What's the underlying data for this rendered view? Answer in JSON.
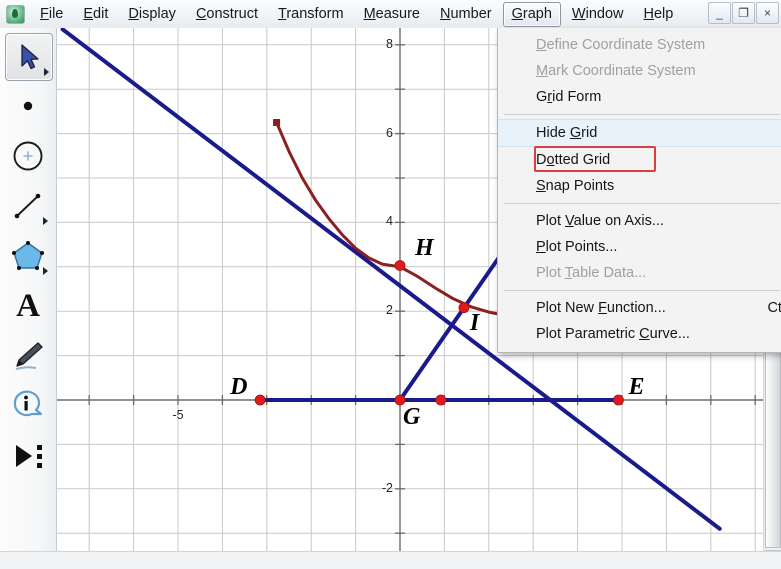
{
  "window": {
    "app_icon": "sketchpad-icon",
    "controls": [
      {
        "name": "minimize-button",
        "glyph": "_"
      },
      {
        "name": "restore-button",
        "glyph": "❐"
      },
      {
        "name": "close-button",
        "glyph": "×"
      }
    ]
  },
  "menubar": {
    "items": [
      {
        "label": "File",
        "mnemonic": "F",
        "active": false
      },
      {
        "label": "Edit",
        "mnemonic": "E",
        "active": false
      },
      {
        "label": "Display",
        "mnemonic": "D",
        "active": false
      },
      {
        "label": "Construct",
        "mnemonic": "C",
        "active": false
      },
      {
        "label": "Transform",
        "mnemonic": "T",
        "active": false
      },
      {
        "label": "Measure",
        "mnemonic": "M",
        "active": false
      },
      {
        "label": "Number",
        "mnemonic": "N",
        "active": false
      },
      {
        "label": "Graph",
        "mnemonic": "G",
        "active": true
      },
      {
        "label": "Window",
        "mnemonic": "W",
        "active": false
      },
      {
        "label": "Help",
        "mnemonic": "H",
        "active": false
      }
    ]
  },
  "graph_menu": {
    "open": true,
    "items": [
      {
        "label": "Define Coordinate System",
        "mnemonic": "D",
        "state": "disabled",
        "accel": ""
      },
      {
        "label": "Mark Coordinate System",
        "mnemonic": "M",
        "state": "disabled",
        "accel": ""
      },
      {
        "label": "Grid Form",
        "mnemonic": "r",
        "state": "normal",
        "accel": ""
      },
      {
        "separator": true
      },
      {
        "label": "Hide Grid",
        "mnemonic": "G",
        "state": "highlight",
        "accel": ""
      },
      {
        "label": "Dotted Grid",
        "mnemonic": "o",
        "state": "normal",
        "accel": ""
      },
      {
        "label": "Snap Points",
        "mnemonic": "S",
        "state": "normal",
        "accel": ""
      },
      {
        "separator": true
      },
      {
        "label": "Plot Value on Axis...",
        "mnemonic": "V",
        "state": "normal",
        "accel": ""
      },
      {
        "label": "Plot Points...",
        "mnemonic": "P",
        "state": "normal",
        "accel": ""
      },
      {
        "label": "Plot Table Data...",
        "mnemonic": "T",
        "state": "disabled",
        "accel": ""
      },
      {
        "separator": true
      },
      {
        "label": "Plot New Function...",
        "mnemonic": "F",
        "state": "normal",
        "accel": "Ctrl"
      },
      {
        "label": "Plot Parametric Curve...",
        "mnemonic": "C",
        "state": "normal",
        "accel": ""
      }
    ],
    "annotation": {
      "type": "red-rectangle",
      "target": "Hide Grid",
      "color": "#d93f3f"
    }
  },
  "toolbox": {
    "tools": [
      {
        "name": "arrow-select-tool",
        "icon": "arrow-icon",
        "selected": true,
        "has_flyout": true
      },
      {
        "name": "point-tool",
        "icon": "point-icon",
        "selected": false,
        "has_flyout": false
      },
      {
        "name": "compass-tool",
        "icon": "circle-icon",
        "selected": false,
        "has_flyout": false
      },
      {
        "name": "straightedge-tool",
        "icon": "segment-icon",
        "selected": false,
        "has_flyout": true
      },
      {
        "name": "polygon-tool",
        "icon": "polygon-icon",
        "selected": false,
        "has_flyout": true
      },
      {
        "name": "text-tool",
        "icon": "letter-a-icon",
        "selected": false,
        "has_flyout": false
      },
      {
        "name": "marker-tool",
        "icon": "pen-icon",
        "selected": false,
        "has_flyout": false
      },
      {
        "name": "information-tool",
        "icon": "info-icon",
        "selected": false,
        "has_flyout": false
      },
      {
        "name": "custom-tool",
        "icon": "play-dots-icon",
        "selected": false,
        "has_flyout": false
      }
    ]
  },
  "chart_data": {
    "type": "scatter",
    "title": "",
    "xlabel": "",
    "ylabel": "",
    "xlim": [
      -7.6,
      7.2
    ],
    "ylim": [
      -3.3,
      8.4
    ],
    "grid": true,
    "axis_color": "#6b6b6b",
    "grid_color": "#c8c8c8",
    "object_color": "#1a1a8c",
    "curve_color": "#8a2020",
    "point_color": "#e01b1b",
    "y_ticks": [
      8,
      6,
      4,
      2,
      -2
    ],
    "x_ticks": [
      -5
    ],
    "points": [
      {
        "label": "D",
        "x": -3.15,
        "y": 0,
        "label_dx": -30,
        "label_dy": -26
      },
      {
        "label": "G",
        "x": 0,
        "y": 0,
        "label_dx": 3,
        "label_dy": 4
      },
      {
        "label": "",
        "x": 0.92,
        "y": 0,
        "label_dx": 0,
        "label_dy": 0
      },
      {
        "label": "E",
        "x": 4.92,
        "y": 0,
        "label_dx": 10,
        "label_dy": -26
      },
      {
        "label": "H",
        "x": 0,
        "y": 3.03,
        "label_dx": 15,
        "label_dy": -30
      },
      {
        "label": "I",
        "x": 1.44,
        "y": 2.08,
        "label_dx": 6,
        "label_dy": 2
      }
    ],
    "segments": [
      {
        "name": "horizontal-segment-DE",
        "x1": -3.15,
        "y1": 0,
        "x2": 4.92,
        "y2": 0
      },
      {
        "name": "ray-G-through-I",
        "x1": 0,
        "y1": 0,
        "x2": 2.9,
        "y2": 4.18
      },
      {
        "name": "descending-line",
        "x1": -7.6,
        "y1": 8.35,
        "x2": 7.2,
        "y2": -2.9
      }
    ],
    "curve": {
      "name": "exponential-decay-curve",
      "color": "#8a2020",
      "start_marker": "square",
      "points": [
        [
          -2.78,
          6.25
        ],
        [
          -2.5,
          5.6
        ],
        [
          -2.2,
          5.0
        ],
        [
          -1.9,
          4.5
        ],
        [
          -1.6,
          4.08
        ],
        [
          -1.3,
          3.72
        ],
        [
          -1.0,
          3.42
        ],
        [
          -0.7,
          3.2
        ],
        [
          -0.4,
          3.06
        ],
        [
          0.0,
          3.0
        ],
        [
          0.4,
          2.78
        ],
        [
          0.8,
          2.52
        ],
        [
          1.2,
          2.28
        ],
        [
          1.6,
          2.1
        ],
        [
          2.0,
          1.98
        ],
        [
          2.5,
          1.88
        ],
        [
          2.9,
          1.84
        ]
      ]
    }
  }
}
